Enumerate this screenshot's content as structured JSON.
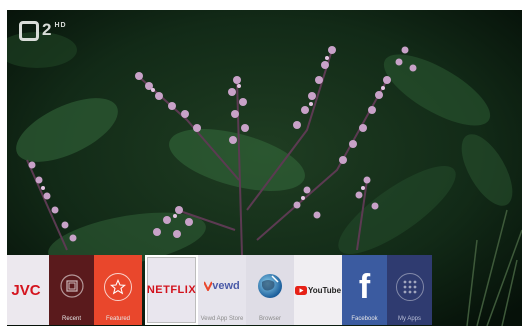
{
  "channel": {
    "logo_text": "2",
    "hd_text": "HD"
  },
  "launcher": {
    "tiles": [
      {
        "id": "jvc",
        "logo": "JVC",
        "caption": ""
      },
      {
        "id": "recent",
        "caption": "Recent"
      },
      {
        "id": "featured",
        "caption": "Featured"
      },
      {
        "id": "netflix",
        "logo": "NETFLIX",
        "caption": ""
      },
      {
        "id": "vewd",
        "logo": "vewd",
        "caption": "Vewd App Store"
      },
      {
        "id": "browser",
        "caption": "Browser"
      },
      {
        "id": "youtube",
        "logo": "YouTube",
        "caption": ""
      },
      {
        "id": "facebook",
        "logo": "f",
        "caption": "Facebook"
      },
      {
        "id": "myapps",
        "caption": "My Apps"
      }
    ]
  },
  "colors": {
    "netflix_red": "#d2121c",
    "featured_orange": "#e9472c",
    "facebook_blue": "#3b5ba0",
    "myapps_navy": "#2f3b70"
  },
  "icons": {
    "recent": "recent-square-icon",
    "featured": "star-icon",
    "browser": "globe-icon",
    "myapps": "grid-icon"
  }
}
